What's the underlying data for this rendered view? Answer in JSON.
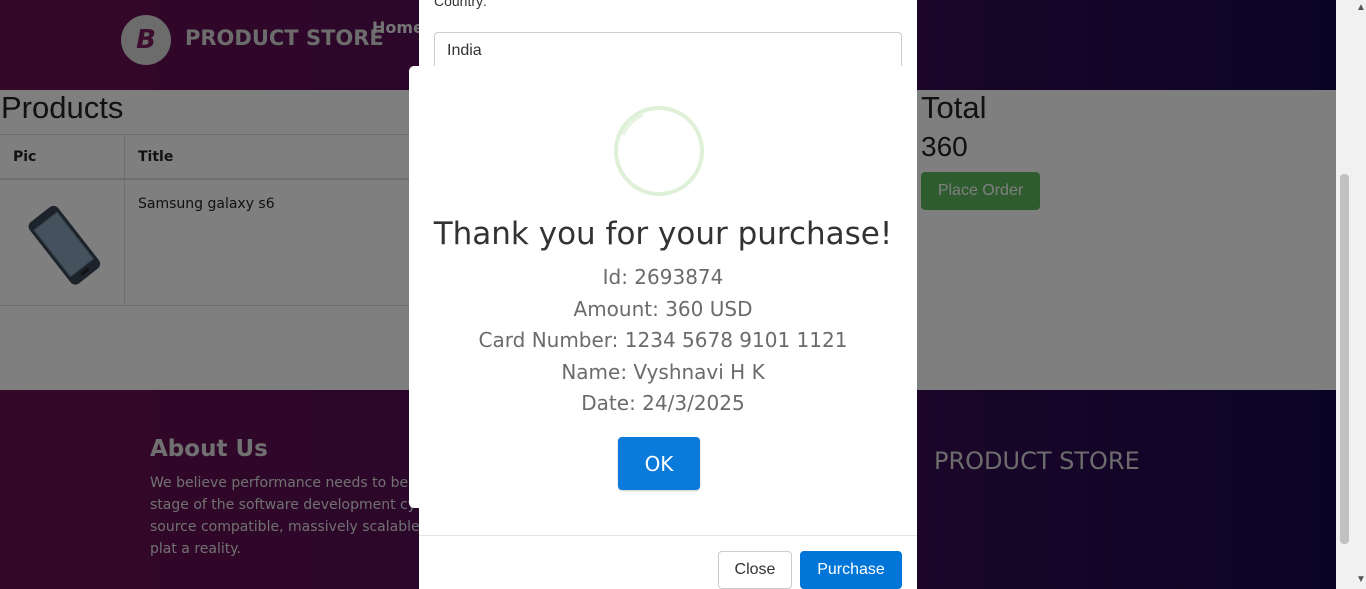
{
  "navbar": {
    "brand_logo": "B",
    "brand_name": "PRODUCT STORE",
    "home": "Home"
  },
  "products": {
    "title": "Products",
    "columns": [
      "Pic",
      "Title"
    ],
    "rows": [
      {
        "title": "Samsung galaxy s6"
      }
    ]
  },
  "total": {
    "label": "Total",
    "value": "360",
    "place_order": "Place Order"
  },
  "footer": {
    "about_title": "About Us",
    "about_text": "We believe performance needs to be val stage of the software development cycle source compatible, massively scalable plat a reality.",
    "brand": "PRODUCT STORE"
  },
  "order_modal": {
    "country_label": "Country:",
    "country_value": "India",
    "close": "Close",
    "purchase": "Purchase"
  },
  "alert": {
    "title": "Thank you for your purchase!",
    "id": "Id: 2693874",
    "amount": "Amount: 360 USD",
    "card": "Card Number: 1234 5678 9101 1121",
    "name": "Name: Vyshnavi H K",
    "date": "Date: 24/3/2025",
    "ok": "OK"
  },
  "colors": {
    "primary": "#0275d8",
    "success": "#5cb85c",
    "ok": "#0a7adb",
    "nav_start": "#6b0f4f",
    "nav_end": "#160a4a"
  }
}
